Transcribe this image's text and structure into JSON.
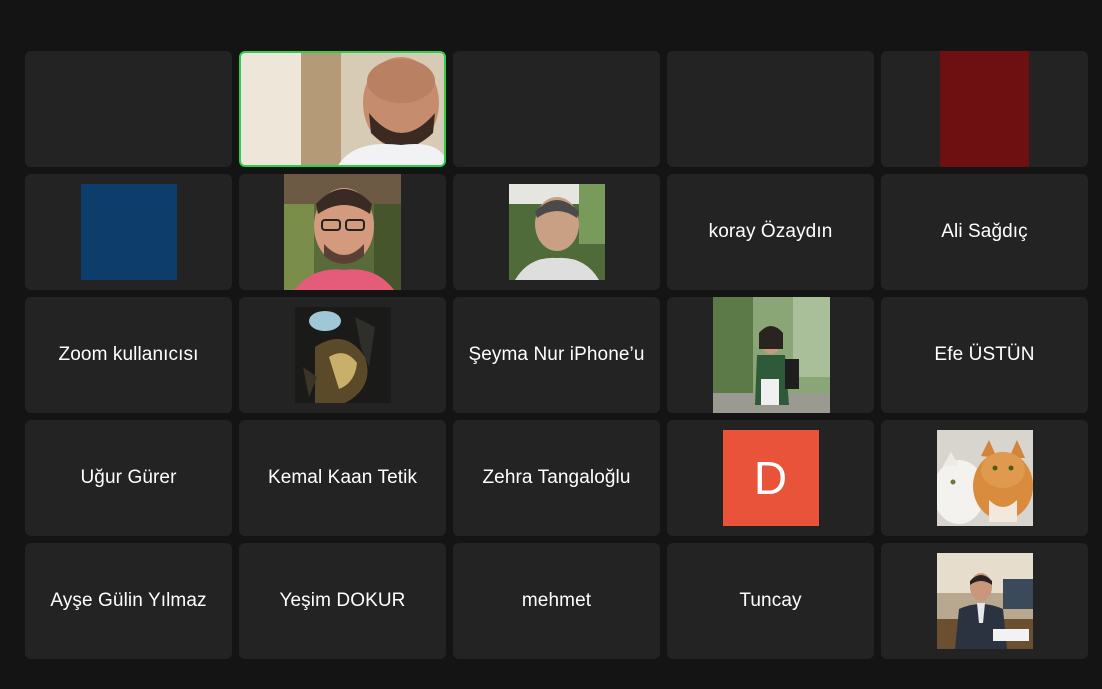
{
  "participants": [
    {
      "id": "r1c1",
      "name": ""
    },
    {
      "id": "r1c2",
      "name": "",
      "avatar": "video-feed",
      "speaking": true
    },
    {
      "id": "r1c3",
      "name": ""
    },
    {
      "id": "r1c4",
      "name": ""
    },
    {
      "id": "r1c5",
      "name": "",
      "avatar": "dark-red-block"
    },
    {
      "id": "r2c1",
      "name": "",
      "avatar": "blue-block"
    },
    {
      "id": "r2c2",
      "name": "",
      "avatar": "photo-man-glasses"
    },
    {
      "id": "r2c3",
      "name": "",
      "avatar": "photo-man-outdoors"
    },
    {
      "id": "r2c4",
      "name": "koray Özaydın"
    },
    {
      "id": "r2c5",
      "name": "Ali Sağdıç"
    },
    {
      "id": "r3c1",
      "name": "Zoom kullanıcısı"
    },
    {
      "id": "r3c2",
      "name": "",
      "avatar": "comic-art"
    },
    {
      "id": "r3c3",
      "name": "Şeyma Nur iPhone’u"
    },
    {
      "id": "r3c4",
      "name": "",
      "avatar": "photo-woman-outdoors"
    },
    {
      "id": "r3c5",
      "name": "Efe ÜSTÜN"
    },
    {
      "id": "r4c1",
      "name": "Uğur Gürer"
    },
    {
      "id": "r4c2",
      "name": "Kemal Kaan Tetik"
    },
    {
      "id": "r4c3",
      "name": "Zehra Tangaloğlu"
    },
    {
      "id": "r4c4",
      "name": "",
      "initial": "D",
      "avatar": "initial-badge"
    },
    {
      "id": "r4c5",
      "name": "",
      "avatar": "photo-cats"
    },
    {
      "id": "r5c1",
      "name": "Ayşe Gülin Yılmaz"
    },
    {
      "id": "r5c2",
      "name": "Yeşim DOKUR"
    },
    {
      "id": "r5c3",
      "name": "mehmet"
    },
    {
      "id": "r5c4",
      "name": "Tuncay"
    },
    {
      "id": "r5c5",
      "name": "",
      "avatar": "photo-man-office"
    }
  ],
  "colors": {
    "background": "#141414",
    "tile": "#232323",
    "active_border": "#2ad04b",
    "initial_badge": "#e8533a",
    "blue_block": "#0d3d6b",
    "red_block": "#6e0f12"
  }
}
